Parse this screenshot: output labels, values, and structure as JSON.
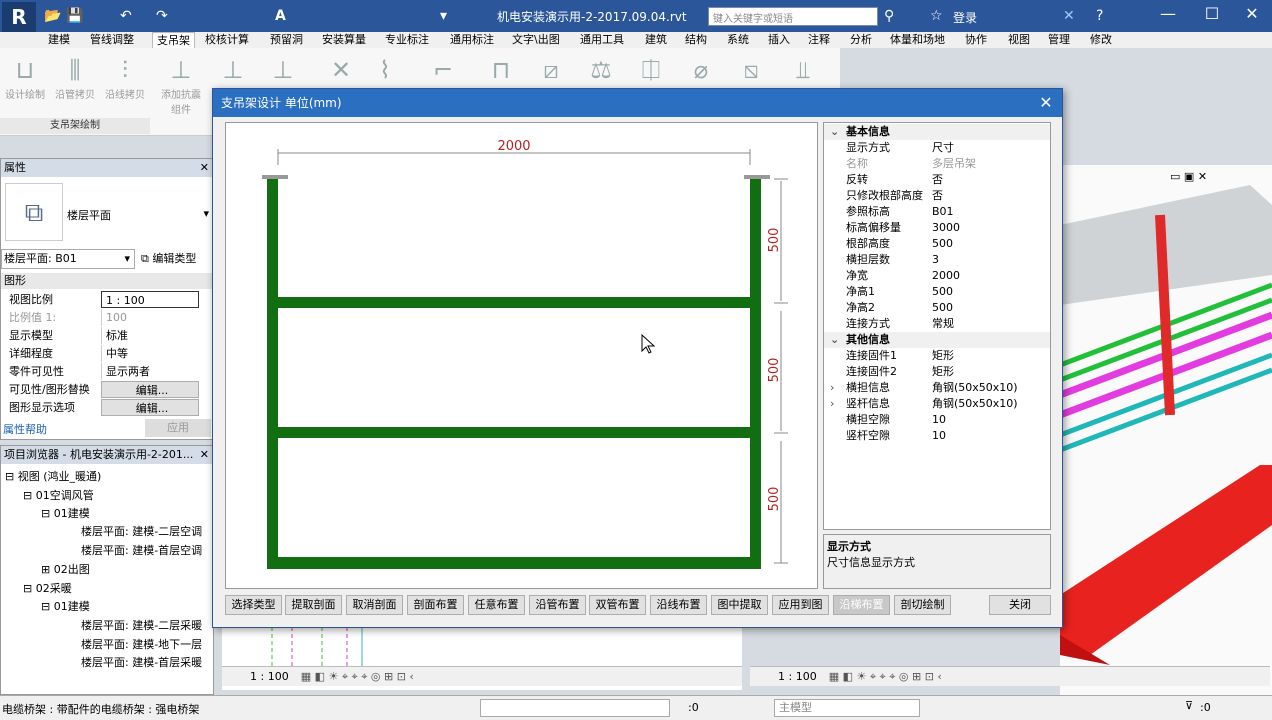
{
  "app": {
    "title": "机电安装演示用-2-2017.09.04.rvt",
    "search_placeholder": "键入关键字或短语",
    "login": "登录",
    "accent": "#2b579a"
  },
  "ribbon": {
    "tabs": [
      "建模",
      "管线调整",
      "支吊架",
      "校核计算",
      "预留洞",
      "安装算量",
      "专业标注",
      "通用标注",
      "文字\\出图",
      "通用工具",
      "建筑",
      "结构",
      "系统",
      "插入",
      "注释",
      "分析",
      "体量和场地",
      "协作",
      "视图",
      "管理",
      "修改"
    ],
    "active_tab": "支吊架",
    "buttons": [
      "设计绘制",
      "沿管拷贝",
      "沿线拷贝",
      "添加抗震组件"
    ],
    "panel_label": "支吊架绘制"
  },
  "properties": {
    "title": "属性",
    "type_name": "楼层平面",
    "selector": "楼层平面: B01",
    "edit_type": "编辑类型",
    "group": "图形",
    "rows": [
      {
        "k": "视图比例",
        "v": "1 : 100"
      },
      {
        "k": "比例值 1:",
        "v": "100"
      },
      {
        "k": "显示模型",
        "v": "标准"
      },
      {
        "k": "详细程度",
        "v": "中等"
      },
      {
        "k": "零件可见性",
        "v": "显示两者"
      },
      {
        "k": "可见性/图形替换",
        "v": "编辑..."
      },
      {
        "k": "图形显示选项",
        "v": "编辑..."
      }
    ],
    "help": "属性帮助",
    "apply": "应用"
  },
  "browser": {
    "title": "项目浏览器 - 机电安装演示用-2-201...",
    "items": [
      "视图 (鸿业_暖通)",
      "01空调风管",
      "01建模",
      "楼层平面: 建模-二层空调",
      "楼层平面: 建模-首层空调",
      "02出图",
      "02采暖",
      "01建模",
      "楼层平面: 建模-二层采暖",
      "楼层平面: 建模-地下一层",
      "楼层平面: 建模-首层采暖"
    ]
  },
  "dialog": {
    "title": "支吊架设计  单位(mm)",
    "drawing": {
      "width_label": "2000",
      "gap_labels": [
        "500",
        "500",
        "500"
      ],
      "frame_color": "#116e11",
      "dim_color": "#b22222"
    },
    "grid": [
      {
        "cat": "基本信息"
      },
      {
        "k": "显示方式",
        "v": "尺寸"
      },
      {
        "k": "名称",
        "v": "多层吊架",
        "dim": true
      },
      {
        "k": "反转",
        "v": "否"
      },
      {
        "k": "只修改根部高度",
        "v": "否"
      },
      {
        "k": "参照标高",
        "v": "B01"
      },
      {
        "k": "标高偏移量",
        "v": "3000"
      },
      {
        "k": "根部高度",
        "v": "500"
      },
      {
        "k": "横担层数",
        "v": "3"
      },
      {
        "k": "净宽",
        "v": "2000"
      },
      {
        "k": "净高1",
        "v": "500"
      },
      {
        "k": "净高2",
        "v": "500"
      },
      {
        "k": "连接方式",
        "v": "常规"
      },
      {
        "cat": "其他信息"
      },
      {
        "k": "连接固件1",
        "v": "矩形"
      },
      {
        "k": "连接固件2",
        "v": "矩形"
      },
      {
        "k": "横担信息",
        "v": "角钢(50x50x10)",
        "exp": true
      },
      {
        "k": "竖杆信息",
        "v": "角钢(50x50x10)",
        "exp": true
      },
      {
        "k": "横担空隙",
        "v": "10"
      },
      {
        "k": "竖杆空隙",
        "v": "10"
      }
    ],
    "desc_title": "显示方式",
    "desc_text": "尺寸信息显示方式",
    "buttons": [
      "选择类型",
      "提取剖面",
      "取消剖面",
      "剖面布置",
      "任意布置",
      "沿管布置",
      "双管布置",
      "沿线布置",
      "图中提取",
      "应用到图",
      "沿梯布置",
      "剖切绘制"
    ],
    "disabled_button": "沿梯布置",
    "close": "关闭"
  },
  "view": {
    "scale": "1 : 100",
    "scale2": "1 : 100"
  },
  "status": {
    "text": "电缆桥架 : 带配件的电缆桥架 : 强电桥架",
    "coord": ":0",
    "model": "主模型",
    "filter": ":0"
  }
}
